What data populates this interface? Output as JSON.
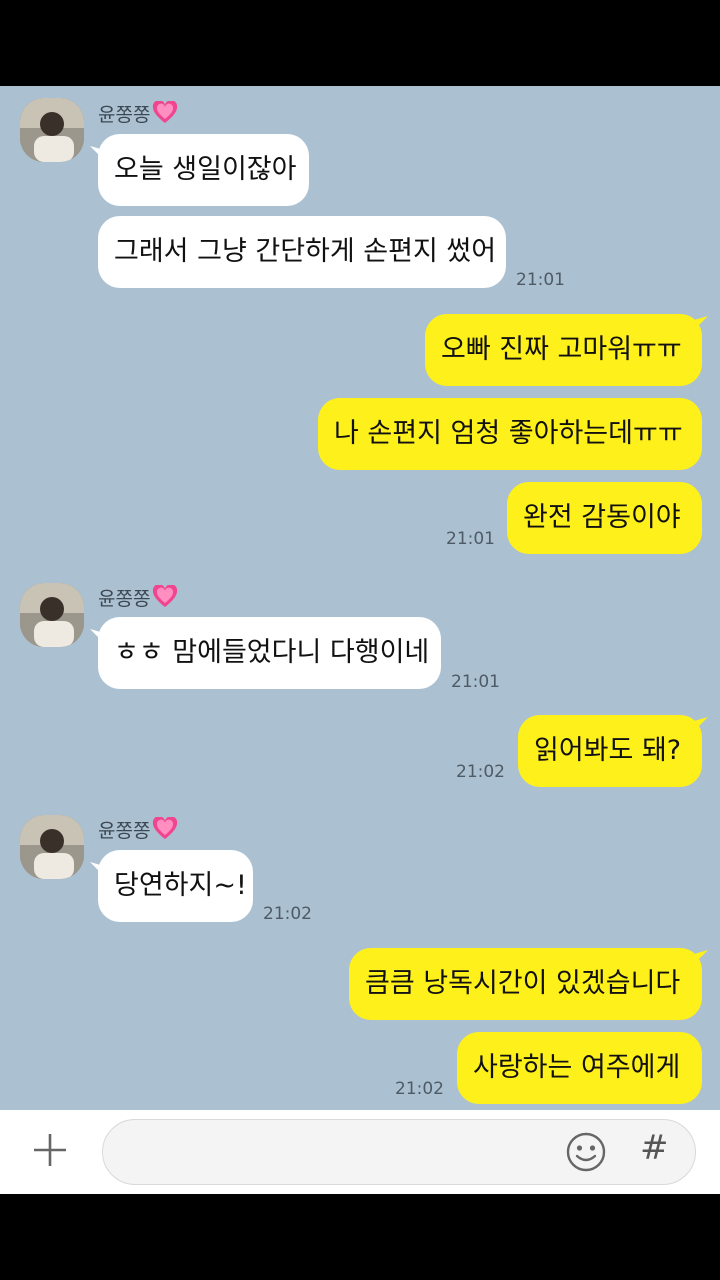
{
  "contact": {
    "name": "윤쫑쫑",
    "heart_icon": "pink-sparkling-heart-icon"
  },
  "messages": [
    {
      "from": "them",
      "text": "오늘 생일이잖아"
    },
    {
      "from": "them",
      "text": "그래서 그냥 간단하게 손편지 썼어",
      "time": "21:01"
    },
    {
      "from": "me",
      "text": "오빠 진짜 고마워ㅠㅠ"
    },
    {
      "from": "me",
      "text": "나 손편지 엄청 좋아하는데ㅠㅠ"
    },
    {
      "from": "me",
      "text": "완전 감동이야",
      "time": "21:01"
    },
    {
      "from": "them",
      "text": "ㅎㅎ 맘에들었다니 다행이네",
      "time": "21:01"
    },
    {
      "from": "me",
      "text": "읽어봐도 돼?",
      "time": "21:02"
    },
    {
      "from": "them",
      "text": "당연하지~!",
      "time": "21:02"
    },
    {
      "from": "me",
      "text": "큼큼 낭독시간이 있겠습니다"
    },
    {
      "from": "me",
      "text": "사랑하는 여주에게",
      "time": "21:02"
    }
  ],
  "input": {
    "placeholder": "",
    "plus_icon": "plus-icon",
    "emoji_icon": "smile-icon",
    "hash_label": "#"
  },
  "colors": {
    "chat_bg": "#abc1d1",
    "my_bubble": "#fef01b",
    "their_bubble": "#ffffff"
  }
}
